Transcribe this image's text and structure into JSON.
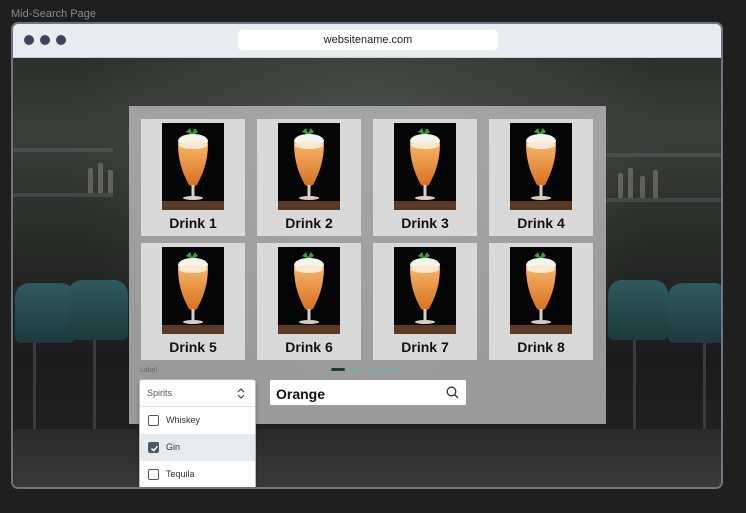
{
  "frame_label": "Mid-Search Page",
  "browser": {
    "url": "websitename.com"
  },
  "drinks": [
    {
      "name": "Drink 1"
    },
    {
      "name": "Drink 2"
    },
    {
      "name": "Drink 3"
    },
    {
      "name": "Drink 4"
    },
    {
      "name": "Drink 5"
    },
    {
      "name": "Drink 6"
    },
    {
      "name": "Drink 7"
    },
    {
      "name": "Drink 8"
    }
  ],
  "pagination": {
    "active_page": 1,
    "total_pages": 4
  },
  "filter": {
    "label": "Label",
    "selected_value": "Spirits",
    "options": [
      {
        "label": "Whiskey",
        "checked": false
      },
      {
        "label": "Gin",
        "checked": true
      },
      {
        "label": "Tequila",
        "checked": false
      }
    ]
  },
  "search": {
    "value": "Orange"
  },
  "colors": {
    "accent_dark": "#1c3c3a",
    "accent_light": "#7fa7a3",
    "checkbox_checked": "#4a5866"
  }
}
